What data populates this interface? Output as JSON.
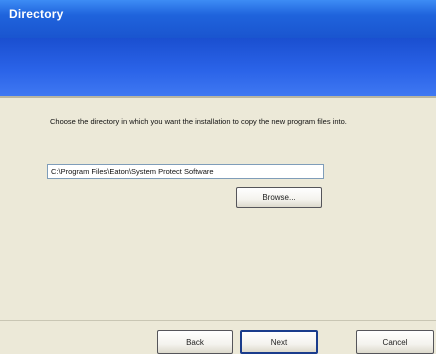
{
  "window": {
    "title": "Directory"
  },
  "content": {
    "instruction": "Choose the directory in which you want the installation to copy the new program files into.",
    "install_path": "C:\\Program Files\\Eaton\\System Protect Software"
  },
  "buttons": {
    "browse": "Browse...",
    "back": "Back",
    "next": "Next",
    "cancel": "Cancel"
  }
}
